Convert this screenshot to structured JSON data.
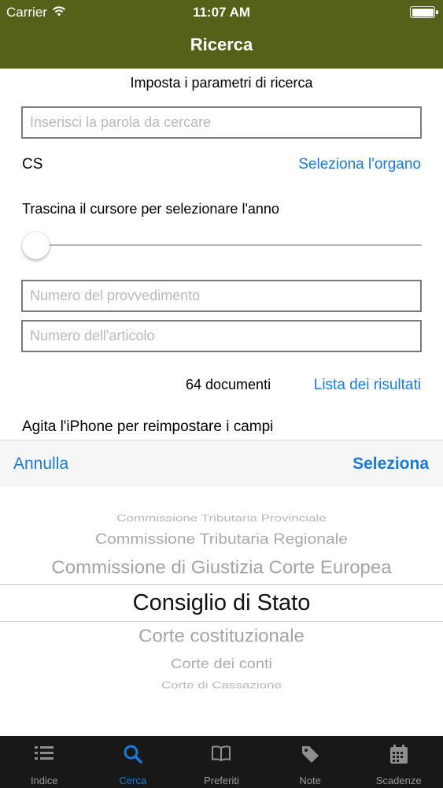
{
  "status_bar": {
    "carrier": "Carrier",
    "time": "11:07 AM"
  },
  "nav": {
    "title": "Ricerca"
  },
  "form": {
    "heading": "Imposta i parametri di ricerca",
    "search_placeholder": "Inserisci la parola da cercare",
    "organ_code": "CS",
    "organ_link": "Seleziona l'organo",
    "slider_label": "Trascina il cursore per selezionare l'anno",
    "slider_value": 0,
    "provvedimento_placeholder": "Numero del provvedimento",
    "articolo_placeholder": "Numero dell'articolo",
    "doc_count": "64 documenti",
    "results_link": "Lista dei risultati",
    "shake_hint": "Agita l'iPhone per reimpostare i campi"
  },
  "picker_toolbar": {
    "cancel_label": "Annulla",
    "select_label": "Seleziona"
  },
  "picker": {
    "options": [
      "Commissione Tributaria Provinciale",
      "Commissione Tributaria Regionale",
      "Commissione di Giustizia Corte Europea",
      "Consiglio di Stato",
      "Corte costituzionale",
      "Corte dei conti",
      "Corte di Cassazione"
    ],
    "selected_index": 3
  },
  "tabs": [
    {
      "label": "Indice",
      "icon": "list-icon",
      "active": false
    },
    {
      "label": "Cerca",
      "icon": "search-icon",
      "active": true
    },
    {
      "label": "Preferiti",
      "icon": "book-icon",
      "active": false
    },
    {
      "label": "Note",
      "icon": "tag-icon",
      "active": false
    },
    {
      "label": "Scadenze",
      "icon": "calendar-icon",
      "active": false
    }
  ],
  "colors": {
    "nav_bar": "#556019",
    "accent": "#1a7ad9",
    "tab_bar": "#181818"
  }
}
